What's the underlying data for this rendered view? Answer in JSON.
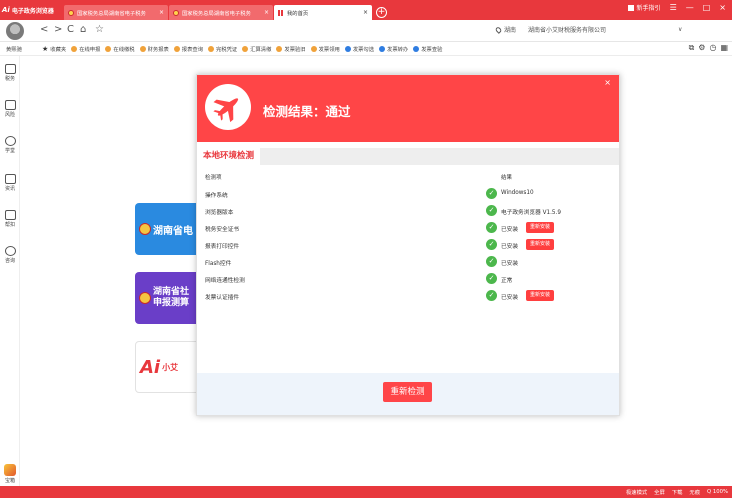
{
  "window": {
    "app_name": "电子政务浏览器",
    "app_logo_text": "Ai",
    "tabs": [
      {
        "label": "国家税务总局湖南省电子税务",
        "active": false,
        "icon": "gov-emblem-icon"
      },
      {
        "label": "国家税务总局湖南省电子税务",
        "active": false,
        "icon": "gov-emblem-icon"
      },
      {
        "label": "我的首页",
        "active": true,
        "icon": "grid-icon"
      }
    ],
    "new_tab_symbol": "+",
    "close_symbol": "×",
    "right_label": "新手指引",
    "controls": [
      "☰",
      "—",
      "□",
      "×"
    ]
  },
  "addressbar": {
    "nav_back": "<",
    "nav_forward": ">",
    "nav_refresh": "C",
    "nav_home": "⌂",
    "bookmark_star": "☆",
    "region": "湖南",
    "company": "湖南省小艾财税服务有限公司",
    "dropdown_symbol": "∨"
  },
  "bookmarks": {
    "left_label": "黄熙驰",
    "items": [
      {
        "label": "收藏夹",
        "icon": "star-icon"
      },
      {
        "label": "在线申报",
        "icon": "gov-emblem-icon"
      },
      {
        "label": "在线缴税",
        "icon": "gov-emblem-icon"
      },
      {
        "label": "财务报表",
        "icon": "gov-emblem-icon"
      },
      {
        "label": "报表查询",
        "icon": "gov-emblem-icon"
      },
      {
        "label": "完税凭证",
        "icon": "gov-emblem-icon"
      },
      {
        "label": "汇算清缴",
        "icon": "gov-emblem-icon"
      },
      {
        "label": "发票验旧",
        "icon": "gov-emblem-icon"
      },
      {
        "label": "发票领用",
        "icon": "gov-emblem-icon"
      },
      {
        "label": "发票勾选",
        "icon": "blue-globe-icon"
      },
      {
        "label": "发票转办",
        "icon": "blue-globe-icon"
      },
      {
        "label": "发票查验",
        "icon": "blue-globe-icon"
      }
    ]
  },
  "sidebar": {
    "items": [
      {
        "label": "税务",
        "icon": "monitor-icon"
      },
      {
        "label": "风险",
        "icon": "shield-icon"
      },
      {
        "label": "学堂",
        "icon": "graduation-cap-icon"
      },
      {
        "label": "资讯",
        "icon": "news-icon"
      },
      {
        "label": "帮扣",
        "icon": "help-icon"
      },
      {
        "label": "咨询",
        "icon": "chat-icon"
      }
    ],
    "bottom_label": "宝箱"
  },
  "background_cards": {
    "card1": "湖南省电",
    "card2_line1": "湖南省社",
    "card2_line2": "申报测算",
    "card3_logo": "Ai",
    "card3_text": "小艾"
  },
  "modal": {
    "title": "检测结果：通过",
    "close_symbol": "×",
    "section_title": "本地环境检测",
    "col_item": "检测项",
    "col_result": "结果",
    "rows": [
      {
        "name": "操作系统",
        "status": "Windows10",
        "button": ""
      },
      {
        "name": "浏览器版本",
        "status": "电子政务浏览器 V1.5.9",
        "button": ""
      },
      {
        "name": "税务安全证书",
        "status": "已安装",
        "button": "重新安装"
      },
      {
        "name": "报表打印控件",
        "status": "已安装",
        "button": "重新安装"
      },
      {
        "name": "Flash控件",
        "status": "已安装",
        "button": ""
      },
      {
        "name": "网络连通性检测",
        "status": "正常",
        "button": ""
      },
      {
        "name": "发票认证插件",
        "status": "已安装",
        "button": "重新安装"
      }
    ],
    "check_symbol": "✓",
    "redetect_label": "重新检测"
  },
  "statusbar": {
    "items": [
      "极速模式",
      "全屏",
      "下载",
      "无痕",
      "Q 100%"
    ]
  },
  "colors": {
    "brand_red": "#e8383d",
    "modal_header": "#ff4547",
    "check_green": "#4cb74c",
    "card_blue": "#2a8ae0",
    "card_purple": "#6a3ec8"
  }
}
